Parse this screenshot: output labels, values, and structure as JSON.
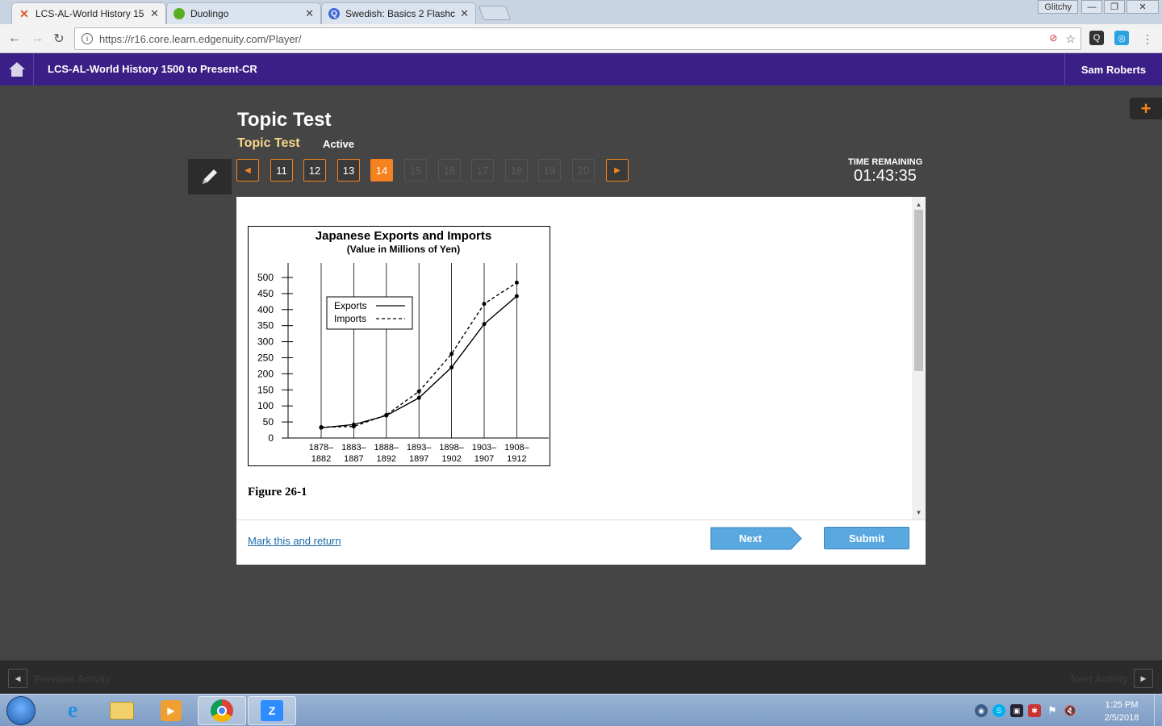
{
  "browser": {
    "tabs": [
      {
        "title": "LCS-AL-World History 15",
        "active": true,
        "icon": "edgenuity-x-icon",
        "color": "#e0592a"
      },
      {
        "title": "Duolingo",
        "active": false,
        "icon": "duolingo-owl-icon",
        "color": "#5aaf1e"
      },
      {
        "title": "Swedish: Basics 2 Flashca",
        "active": false,
        "icon": "quizlet-q-icon",
        "color": "#3f6ad8"
      }
    ],
    "user_chip": "Glitchy",
    "url": "https://r16.core.learn.edgenuity.com/Player/"
  },
  "app": {
    "course_title": "LCS-AL-World History 1500 to Present-CR",
    "user_name": "Sam Roberts",
    "accent": "#f5821f",
    "header_color": "#3a1f86"
  },
  "test": {
    "title": "Topic Test",
    "subtitle": "Topic Test",
    "status": "Active",
    "questions": [
      {
        "label": "11",
        "state": "answered"
      },
      {
        "label": "12",
        "state": "answered"
      },
      {
        "label": "13",
        "state": "answered"
      },
      {
        "label": "14",
        "state": "current"
      },
      {
        "label": "15",
        "state": "disabled"
      },
      {
        "label": "16",
        "state": "disabled"
      },
      {
        "label": "17",
        "state": "disabled"
      },
      {
        "label": "18",
        "state": "disabled"
      },
      {
        "label": "19",
        "state": "disabled"
      },
      {
        "label": "20",
        "state": "disabled"
      }
    ],
    "time_label": "TIME REMAINING",
    "time_value": "01:43:35",
    "figure_caption": "Figure 26-1",
    "mark_return": "Mark this and return",
    "next_label": "Next",
    "submit_label": "Submit"
  },
  "activity_bar": {
    "prev_label": "Previous Activity",
    "next_label": "Next Activity"
  },
  "taskbar": {
    "time": "1:25 PM",
    "date": "2/5/2018"
  },
  "chart_data": {
    "type": "line",
    "title": "Japanese Exports and Imports",
    "subtitle": "(Value in Millions of Yen)",
    "categories": [
      "1878–1882",
      "1883–1887",
      "1888–1892",
      "1893–1897",
      "1898–1902",
      "1903–1907",
      "1908–1912"
    ],
    "ylim": [
      0,
      500
    ],
    "yticks": [
      0,
      50,
      100,
      150,
      200,
      250,
      300,
      350,
      400,
      450,
      500
    ],
    "legend_position": "top-left",
    "series": [
      {
        "name": "Exports",
        "style": "solid",
        "values": [
          32,
          42,
          70,
          125,
          220,
          355,
          442
        ]
      },
      {
        "name": "Imports",
        "style": "dashed",
        "values": [
          34,
          36,
          72,
          145,
          262,
          418,
          484
        ]
      }
    ]
  }
}
